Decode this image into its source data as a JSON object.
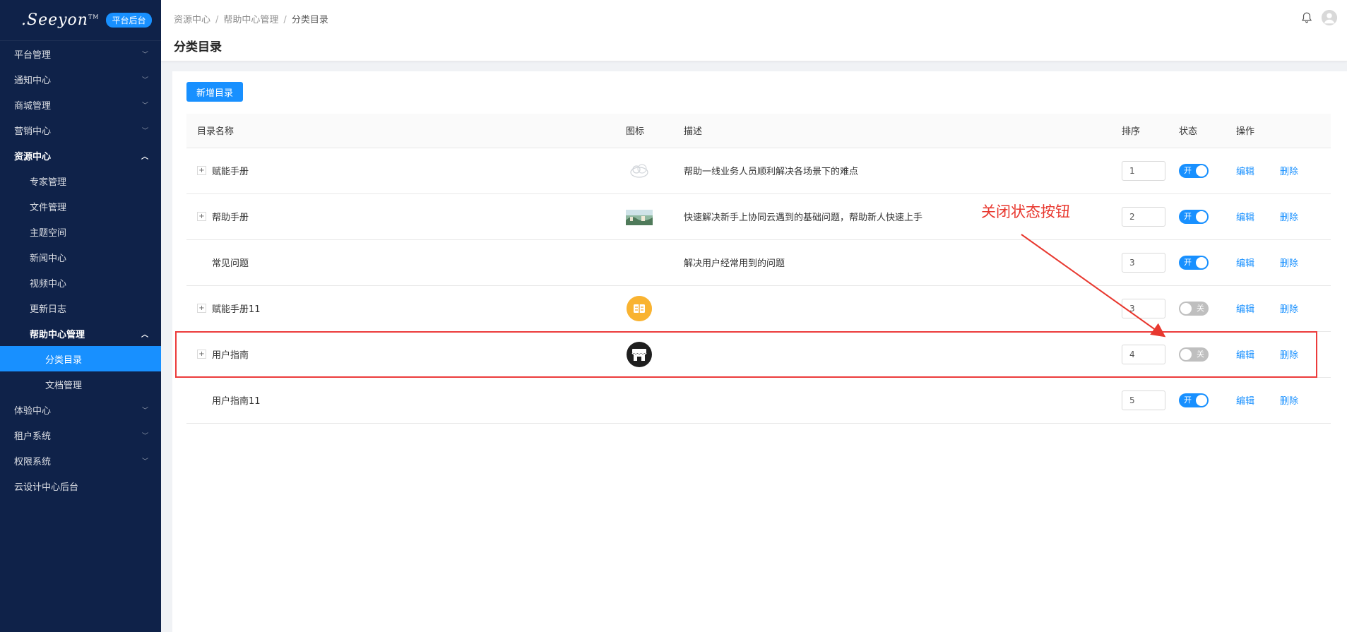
{
  "logo": {
    "brand": ".Seeyon",
    "tm": "TM",
    "badge": "平台后台"
  },
  "sidebar": {
    "items": [
      {
        "label": "平台管理",
        "level": 0,
        "chevron": "down"
      },
      {
        "label": "通知中心",
        "level": 0,
        "chevron": "down"
      },
      {
        "label": "商城管理",
        "level": 0,
        "chevron": "down"
      },
      {
        "label": "营销中心",
        "level": 0,
        "chevron": "down"
      },
      {
        "label": "资源中心",
        "level": 0,
        "chevron": "up",
        "bold": true
      },
      {
        "label": "专家管理",
        "level": 1
      },
      {
        "label": "文件管理",
        "level": 1
      },
      {
        "label": "主题空间",
        "level": 1
      },
      {
        "label": "新闻中心",
        "level": 1
      },
      {
        "label": "视频中心",
        "level": 1
      },
      {
        "label": "更新日志",
        "level": 1
      },
      {
        "label": "帮助中心管理",
        "level": 1,
        "chevron": "up",
        "bold": true
      },
      {
        "label": "分类目录",
        "level": 2,
        "active": true
      },
      {
        "label": "文档管理",
        "level": 2
      },
      {
        "label": "体验中心",
        "level": 0,
        "chevron": "down"
      },
      {
        "label": "租户系统",
        "level": 0,
        "chevron": "down"
      },
      {
        "label": "权限系统",
        "level": 0,
        "chevron": "down"
      },
      {
        "label": "云设计中心后台",
        "level": 0
      }
    ]
  },
  "header": {
    "breadcrumb": [
      "资源中心",
      "帮助中心管理",
      "分类目录"
    ],
    "breadcrumb_sep": "/",
    "title": "分类目录"
  },
  "main": {
    "add_button": "新增目录",
    "table": {
      "columns": [
        "目录名称",
        "图标",
        "描述",
        "排序",
        "状态",
        "操作"
      ],
      "rows": [
        {
          "name": "赋能手册",
          "expandable": true,
          "icon": "cloud-sketch-icon",
          "desc": "帮助一线业务人员顺利解决各场景下的难点",
          "order": "1",
          "status": "on"
        },
        {
          "name": "帮助手册",
          "expandable": true,
          "icon": "landscape-photo-icon",
          "desc": "快速解决新手上协同云遇到的基础问题，帮助新人快速上手",
          "order": "2",
          "status": "on"
        },
        {
          "name": "常见问题",
          "expandable": false,
          "icon": "",
          "desc": "解决用户经常用到的问题",
          "order": "3",
          "status": "on"
        },
        {
          "name": "赋能手册11",
          "expandable": true,
          "icon": "orange-book-icon",
          "desc": "",
          "order": "3",
          "status": "off"
        },
        {
          "name": "用户指南",
          "expandable": true,
          "icon": "store-icon",
          "desc": "",
          "order": "4",
          "status": "off"
        },
        {
          "name": "用户指南11",
          "expandable": false,
          "icon": "",
          "desc": "",
          "order": "5",
          "status": "on"
        }
      ],
      "switch_on": "开",
      "switch_off": "关",
      "edit": "编辑",
      "delete": "删除",
      "expand_symbol": "+"
    }
  },
  "annotation": {
    "text": "关闭状态按钮",
    "color": "#e8382f"
  },
  "colors": {
    "primary": "#1890ff",
    "sidebar": "#0f2249",
    "annotation": "#ec3c3c"
  }
}
